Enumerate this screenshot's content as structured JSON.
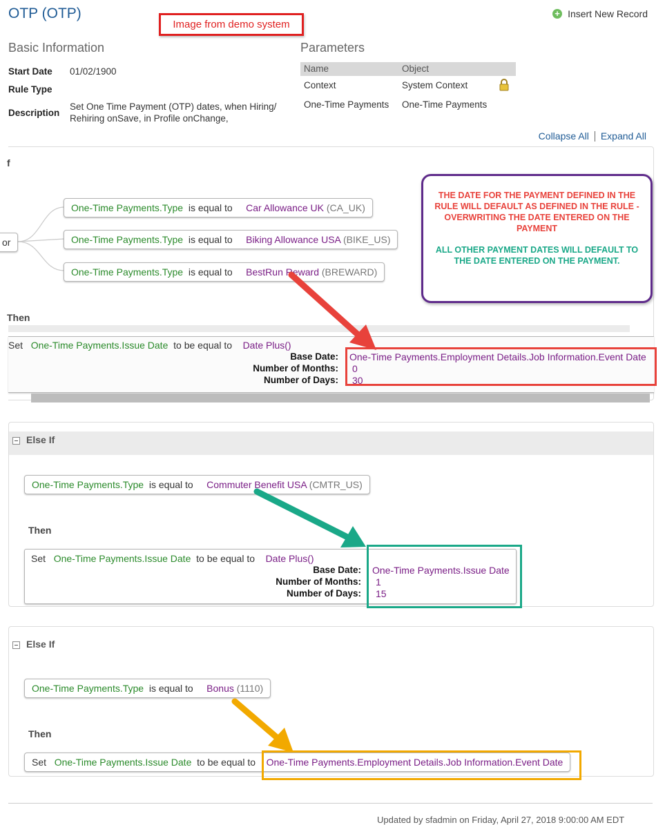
{
  "page": {
    "title": "OTP (OTP)",
    "demo_label": "Image from demo system",
    "insert_label": "Insert New Record"
  },
  "basic": {
    "heading": "Basic Information",
    "start_date_label": "Start Date",
    "start_date": "01/02/1900",
    "rule_type_label": "Rule Type",
    "description_label": "Description",
    "description_line1": "Set  One Time Payment (OTP) dates, when Hiring/",
    "description_line2": "Rehiring onSave, in Profile onChange,"
  },
  "params": {
    "heading": "Parameters",
    "col_name": "Name",
    "col_object": "Object",
    "rows": [
      {
        "name": "Context",
        "object": "System Context"
      },
      {
        "name": "One-Time Payments",
        "object": "One-Time Payments"
      }
    ]
  },
  "links": {
    "collapse": "Collapse All",
    "expand": "Expand All"
  },
  "if_block": {
    "if_label": "f",
    "or_label": "or",
    "then_label": "Then",
    "conditions": [
      {
        "field": "One-Time Payments.Type",
        "op": "is equal to",
        "value": "Car Allowance UK",
        "code": "(CA_UK)"
      },
      {
        "field": "One-Time Payments.Type",
        "op": "is equal to",
        "value": "Biking Allowance USA",
        "code": "(BIKE_US)"
      },
      {
        "field": "One-Time Payments.Type",
        "op": "is equal to",
        "value": "BestRun Reward",
        "code": "(BREWARD)"
      }
    ],
    "set": {
      "set": "Set",
      "field": "One-Time Payments.Issue Date",
      "op": "to be equal to",
      "func": "Date Plus()",
      "base_label": "Base Date:",
      "base": "One-Time Payments.Employment Details.Job Information.Event Date",
      "months_label": "Number of Months:",
      "months": "0",
      "days_label": "Number of Days:",
      "days": "30"
    }
  },
  "note": {
    "red": "THE DATE FOR THE PAYMENT  DEFINED IN THE RULE WILL DEFAULT AS DEFINED IN THE RULE - OVERWRITING THE DATE ENTERED ON THE PAYMENT",
    "teal": "ALL OTHER PAYMENT DATES WILL DEFAULT TO THE DATE ENTERED ON THE PAYMENT."
  },
  "else1": {
    "label": "Else If",
    "then_label": "Then",
    "cond": {
      "field": "One-Time Payments.Type",
      "op": "is equal to",
      "value": "Commuter Benefit USA",
      "code": "(CMTR_US)"
    },
    "set": {
      "set": "Set",
      "field": "One-Time Payments.Issue Date",
      "op": "to be equal to",
      "func": "Date Plus()",
      "base_label": "Base Date:",
      "base": "One-Time Payments.Issue Date",
      "months_label": "Number of Months:",
      "months": "1",
      "days_label": "Number of Days:",
      "days": "15"
    }
  },
  "else2": {
    "label": "Else If",
    "then_label": "Then",
    "cond": {
      "field": "One-Time Payments.Type",
      "op": "is equal to",
      "value": "Bonus",
      "code": "(1110)"
    },
    "set": {
      "set": "Set",
      "field": "One-Time Payments.Issue Date",
      "op": "to be equal to",
      "value": "One-Time Payments.Employment Details.Job Information.Event Date"
    }
  },
  "footer": {
    "updated": "Updated by sfadmin on Friday, April 27, 2018 9:00:00 AM EDT"
  },
  "colors": {
    "red": "#e8423b",
    "teal": "#1aa888",
    "orange": "#f2a900",
    "purple": "#5e2a8a"
  }
}
